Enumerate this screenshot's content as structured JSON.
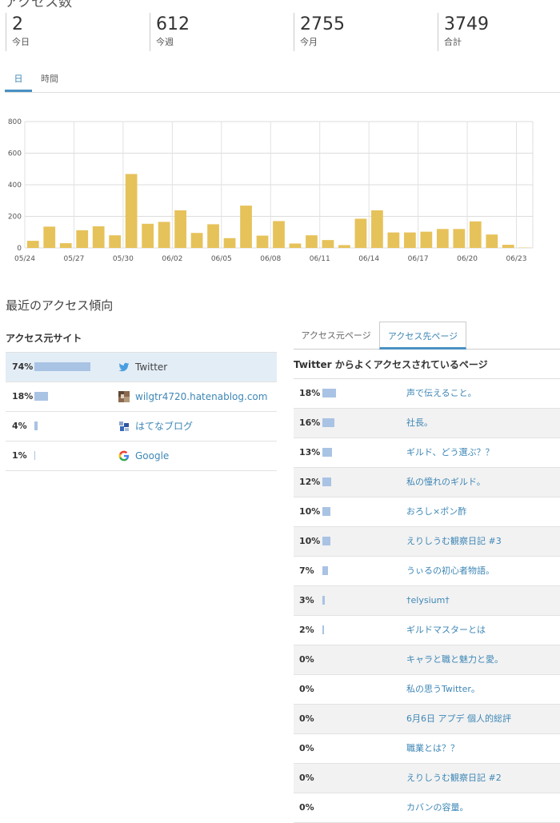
{
  "header": {
    "title": "アクセス数"
  },
  "stats": [
    {
      "value": "2",
      "label": "今日"
    },
    {
      "value": "612",
      "label": "今週"
    },
    {
      "value": "2755",
      "label": "今月"
    },
    {
      "value": "3749",
      "label": "合計"
    }
  ],
  "period_tabs": [
    {
      "label": "日",
      "active": true
    },
    {
      "label": "時間",
      "active": false
    }
  ],
  "chart_data": {
    "type": "bar",
    "title": "",
    "xlabel": "",
    "ylabel": "",
    "ylim": [
      0,
      800
    ],
    "yticks": [
      "0",
      "200",
      "400",
      "600",
      "800"
    ],
    "xtick_labels": [
      "05/24",
      "05/27",
      "05/30",
      "06/02",
      "06/05",
      "06/08",
      "06/11",
      "06/14",
      "06/17",
      "06/20",
      "06/23"
    ],
    "grid": true,
    "color": "#e6c25a",
    "categories": [
      "05/24",
      "05/25",
      "05/26",
      "05/27",
      "05/28",
      "05/29",
      "05/30",
      "05/31",
      "06/01",
      "06/02",
      "06/03",
      "06/04",
      "06/05",
      "06/06",
      "06/07",
      "06/08",
      "06/09",
      "06/10",
      "06/11",
      "06/12",
      "06/13",
      "06/14",
      "06/15",
      "06/16",
      "06/17",
      "06/18",
      "06/19",
      "06/20",
      "06/21",
      "06/22",
      "06/23"
    ],
    "values": [
      45,
      135,
      30,
      112,
      137,
      80,
      468,
      153,
      165,
      238,
      95,
      150,
      62,
      268,
      78,
      170,
      28,
      80,
      50,
      18,
      185,
      238,
      98,
      98,
      103,
      120,
      120,
      168,
      85,
      20,
      2
    ]
  },
  "trends": {
    "title": "最近のアクセス傾向"
  },
  "referrers": {
    "title": "アクセス元サイト",
    "items": [
      {
        "percent": "74%",
        "value": 74,
        "icon": "twitter-icon",
        "name": "Twitter",
        "link": false
      },
      {
        "percent": "18%",
        "value": 18,
        "icon": "blog-avatar-icon",
        "name": "wilgtr4720.hatenablog.com",
        "link": true
      },
      {
        "percent": "4%",
        "value": 4,
        "icon": "hatena-blog-icon",
        "name": "はてなブログ",
        "link": true
      },
      {
        "percent": "1%",
        "value": 1,
        "icon": "google-icon",
        "name": "Google",
        "link": true
      }
    ]
  },
  "pages": {
    "tabs": [
      {
        "label": "アクセス元ページ",
        "active": false
      },
      {
        "label": "アクセス先ページ",
        "active": true
      }
    ],
    "heading": "Twitter からよくアクセスされているページ",
    "items": [
      {
        "percent": "18%",
        "value": 18,
        "title": "声で伝えること。"
      },
      {
        "percent": "16%",
        "value": 16,
        "title": "社長。"
      },
      {
        "percent": "13%",
        "value": 13,
        "title": "ギルド、どう選ぶ？？"
      },
      {
        "percent": "12%",
        "value": 12,
        "title": "私の憧れのギルド。"
      },
      {
        "percent": "10%",
        "value": 10,
        "title": "おろし×ポン酢"
      },
      {
        "percent": "10%",
        "value": 10,
        "title": "えりしうむ観察日記 #3"
      },
      {
        "percent": "7%",
        "value": 7,
        "title": "うぃるの初心者物語。"
      },
      {
        "percent": "3%",
        "value": 3,
        "title": "†elysium†"
      },
      {
        "percent": "2%",
        "value": 2,
        "title": "ギルドマスターとは"
      },
      {
        "percent": "0%",
        "value": 0,
        "title": "キャラと職と魅力と愛。"
      },
      {
        "percent": "0%",
        "value": 0,
        "title": "私の思うTwitter。"
      },
      {
        "percent": "0%",
        "value": 0,
        "title": "6月6日 アプデ 個人的総評"
      },
      {
        "percent": "0%",
        "value": 0,
        "title": "職業とは？？"
      },
      {
        "percent": "0%",
        "value": 0,
        "title": "えりしうむ観察日記 #2"
      },
      {
        "percent": "0%",
        "value": 0,
        "title": "カバンの容量。"
      }
    ]
  }
}
